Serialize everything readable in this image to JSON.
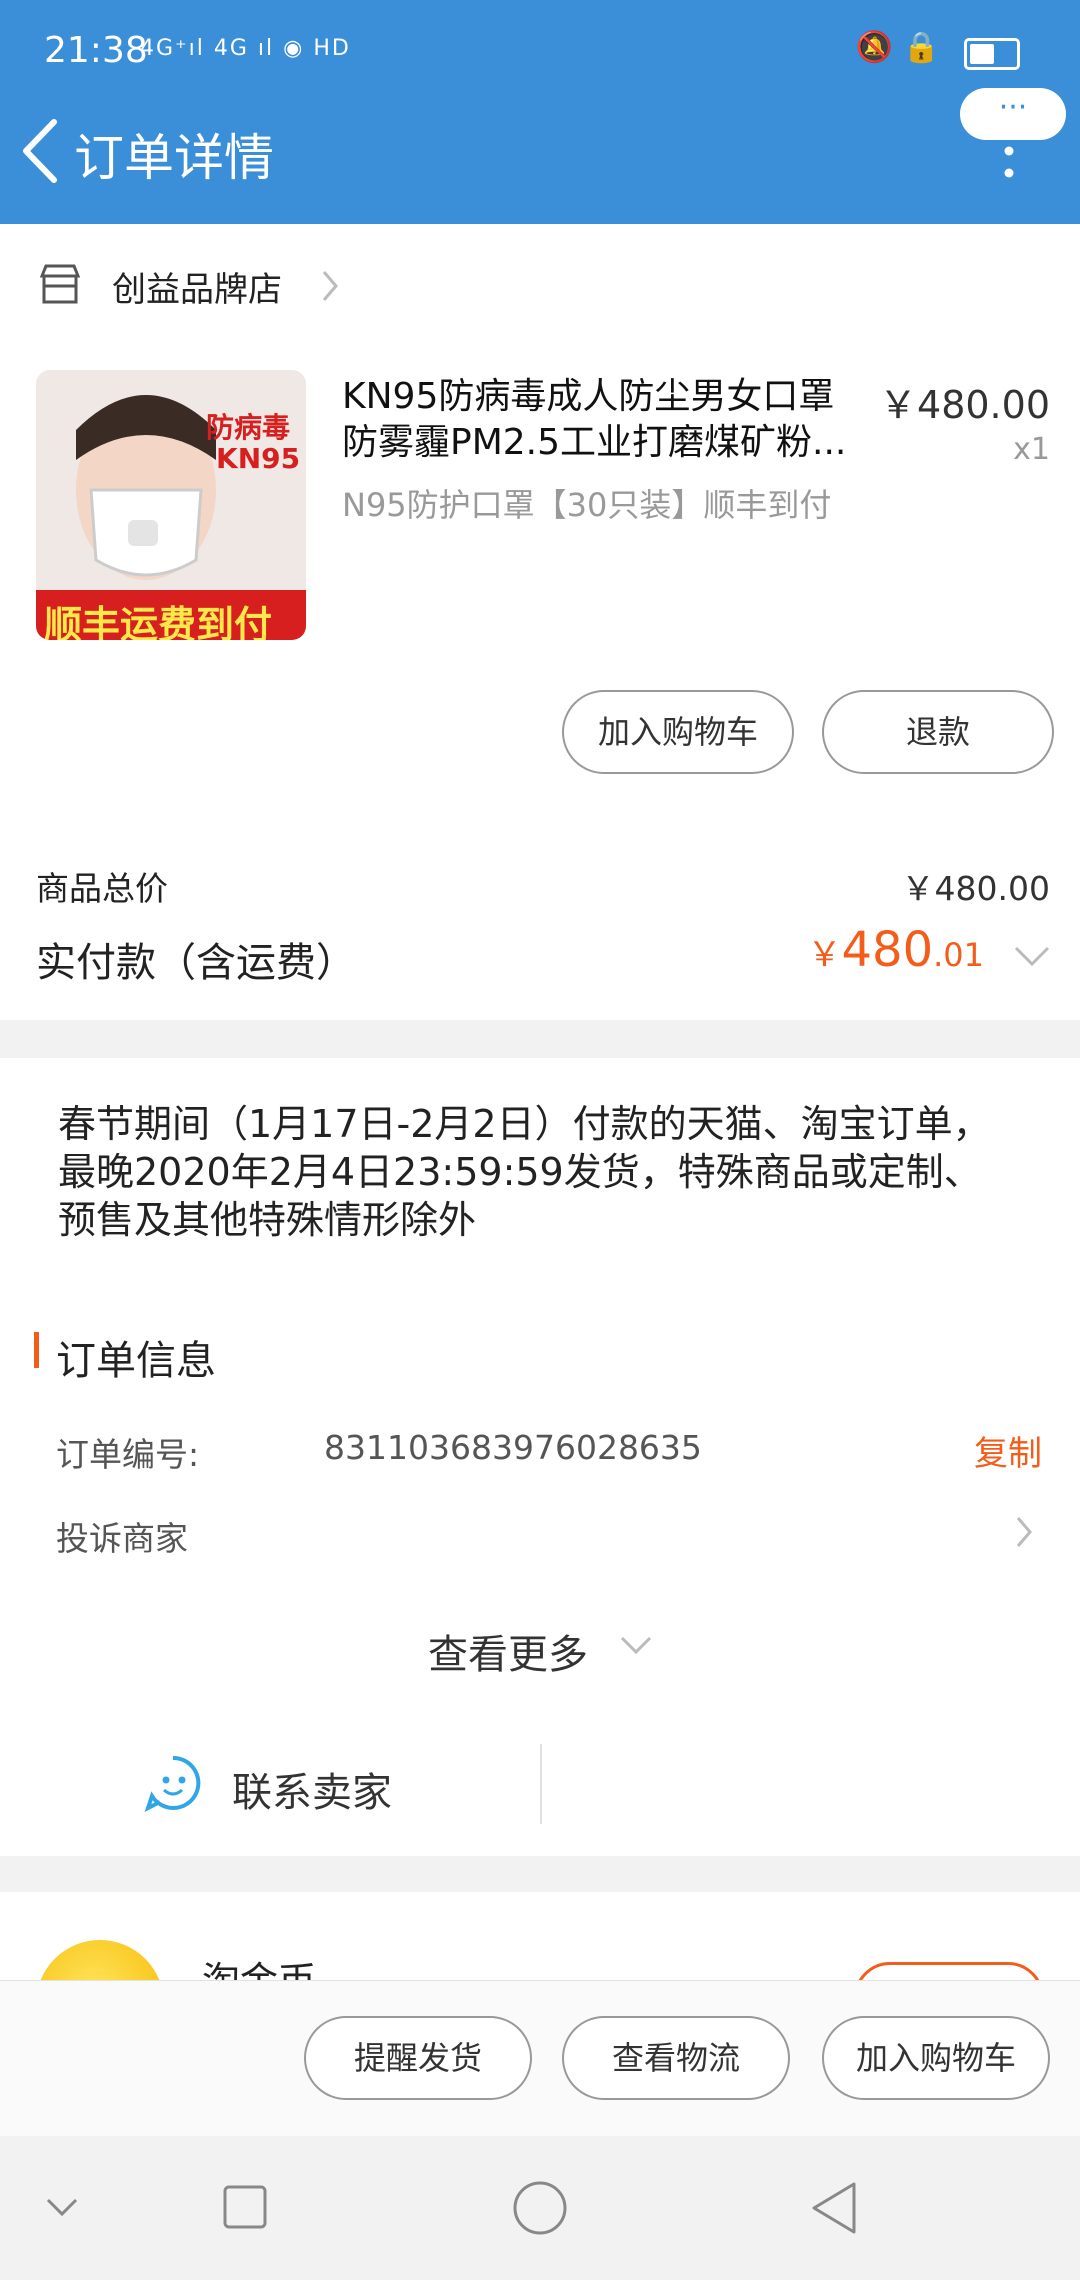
{
  "status_bar": {
    "time": "21:38",
    "signal": "4G⁺ıl  4G ıl  ◉ HD",
    "right_icons": "🔕 🔒"
  },
  "header": {
    "title": "订单详情",
    "more_label": "···"
  },
  "store": {
    "name": "创益品牌店"
  },
  "product": {
    "title": "KN95防病毒成人防尘男女口罩防雾霾PM2.5工业打磨煤矿粉...",
    "price": "￥480.00",
    "qty": "x1",
    "sku": "N95防护口罩【30只装】顺丰到付",
    "image_text_top": "防病毒",
    "image_text_mid": "KN95",
    "image_text_bottom": "顺丰运费到付"
  },
  "item_actions": {
    "add_cart": "加入购物车",
    "refund": "退款"
  },
  "summary": {
    "goods_total_label": "商品总价",
    "goods_total_value": "￥480.00",
    "paid_label": "实付款（含运费）",
    "paid_currency": "￥",
    "paid_int": "480",
    "paid_dec": ".01"
  },
  "notice": "春节期间（1月17日-2月2日）付款的天猫、淘宝订单，最晚2020年2月4日23:59:59发货，特殊商品或定制、预售及其他特殊情形除外",
  "order_info": {
    "title": "订单信息",
    "number_label": "订单编号:",
    "number_value": "831103683976028635",
    "copy": "复制",
    "complain": "投诉商家",
    "see_more": "查看更多"
  },
  "contact": {
    "label": "联系卖家"
  },
  "coin": {
    "label": "淘金币"
  },
  "bottom_actions": {
    "remind": "提醒发货",
    "logistics": "查看物流",
    "add_cart": "加入购物车"
  },
  "colors": {
    "header_blue": "#3b8ed8",
    "accent_orange": "#f35c19"
  }
}
